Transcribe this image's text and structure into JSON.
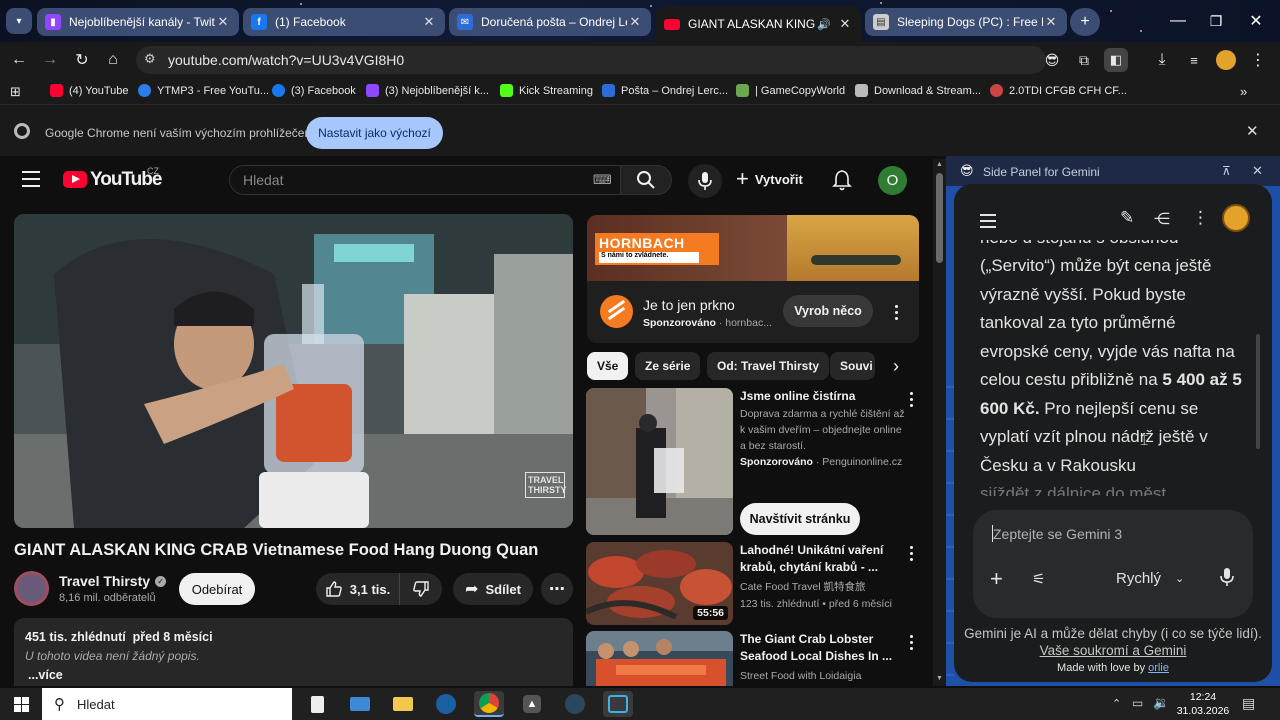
{
  "tabs": [
    {
      "title": "Nejoblíbenější kanály - Twitch",
      "icon": "twitch-icon",
      "color": "#9146ff"
    },
    {
      "title": "(1) Facebook",
      "icon": "facebook-icon",
      "color": "#1877f2"
    },
    {
      "title": "Doručená pošta – Ondrej Lerch",
      "icon": "mail-icon",
      "color": "#2d6bd8"
    },
    {
      "title": "GIANT ALASKAN KING CRAB",
      "icon": "youtube-icon",
      "color": "#ff0033"
    },
    {
      "title": "Sleeping Dogs (PC) : Free Down",
      "icon": "archive-icon",
      "color": "#cccccc"
    }
  ],
  "address": {
    "url": "youtube.com/watch?v=UU3v4VGI8H0"
  },
  "bookmarks": [
    {
      "label": "(4) YouTube",
      "color": "#ff0033"
    },
    {
      "label": "YTMP3 - Free YouTu...",
      "color": "#2b7de9"
    },
    {
      "label": "(3) Facebook",
      "color": "#1877f2"
    },
    {
      "label": "(3) Nejoblíbenější k...",
      "color": "#9146ff"
    },
    {
      "label": "Kick Streaming",
      "color": "#53fc18"
    },
    {
      "label": "Pošta – Ondrej Lerc...",
      "color": "#2d6bd8"
    },
    {
      "label": "| GameCopyWorld",
      "color": "#6aa84f"
    },
    {
      "label": "Download & Stream...",
      "color": "#bbbbbb"
    },
    {
      "label": "2.0TDI CFGB CFH CF...",
      "color": "#cc4444"
    }
  ],
  "infobar": {
    "text": "Google Chrome není vaším výchozím prohlížečem",
    "button": "Nastavit jako výchozí"
  },
  "youtube": {
    "logo_text": "YouTube",
    "region": "CZ",
    "search_placeholder": "Hledat",
    "create_label": "Vytvořit",
    "avatar_letter": "O",
    "video_title": "GIANT ALASKAN KING CRAB Vietnamese Food Hang Duong Quan",
    "channel_name": "Travel Thirsty",
    "subscribers": "8,16 mil. odběratelů",
    "subscribe_label": "Odebírat",
    "likes": "3,1 tis.",
    "share_label": "Sdílet",
    "views_line": "451 tis. zhlédnutí  před 8 měsíci",
    "no_description": "U tohoto videa není žádný popis.",
    "more_label": "...více",
    "watermark": "TRAVEL THIRSTY",
    "ad": {
      "banner_brand": "HORNBACH",
      "banner_slogan": "S námi to zvládnete.",
      "title": "Je to jen prkno",
      "sponsored": "Sponzorováno",
      "domain": "· hornbac...",
      "cta": "Vyrob něco"
    },
    "chips": [
      "Vše",
      "Ze série",
      "Od: Travel Thirsty",
      "Souvi"
    ],
    "related": [
      {
        "title": "Jsme online čistírna",
        "desc": "Doprava zdarma a rychlé čištění až k vašim dveřím – objednejte online a bez starostí.",
        "sponsored": "Sponzorováno",
        "site": "· Penguinonline.cz",
        "cta": "Navštívit stránku"
      },
      {
        "title": "Lahodné! Unikátní vaření krabů, chytání krabů - ...",
        "channel": "Cate Food Travel 凱特食旅",
        "meta": "123 tis. zhlédnutí • před 6 měsíci",
        "duration": "55:56"
      },
      {
        "title": "The Giant Crab Lobster Seafood Local Dishes In ...",
        "channel": "Street Food with Loidaigia"
      }
    ]
  },
  "gemini": {
    "panel_title": "Side Panel for Gemini",
    "response_lines_top": "nebo u stojanu s obsluhou",
    "response_before": "(„Servito“) může být cena ještě výrazně vyšší. Pokud byste tankoval za tyto průměrné evropské ceny, vyjde vás nafta na celou cestu přibližně na ",
    "response_bold": "5 400 až 5 600 Kč.",
    "response_after": " Pro nejlepší cenu se vyplatí vzít plnou nádrž ještě v Česku a v Rakousku",
    "response_fade": "sjíždět z dálnice do měst.",
    "prompt_placeholder": "Zeptejte se Gemini 3",
    "mode_label": "Rychlý",
    "disclaimer": "Gemini je AI a může dělat chyby (i co se týče lidí).",
    "privacy_link": "Vaše soukromí a Gemini",
    "made_with": "Made with love by",
    "author": "orlie"
  },
  "taskbar": {
    "search_label": "Hledat",
    "time": "12:24",
    "date": "31.03.2026"
  }
}
